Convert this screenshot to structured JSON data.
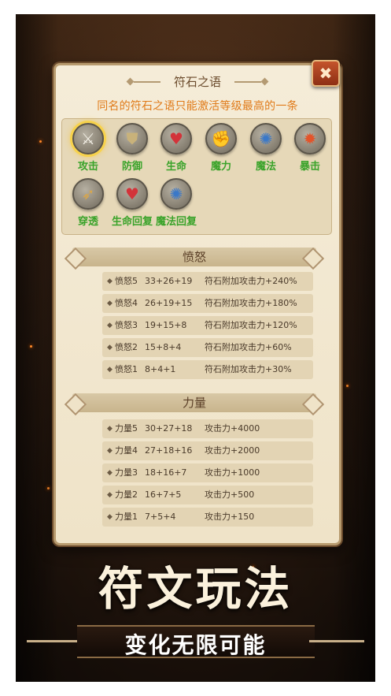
{
  "panel": {
    "title": "符石之语",
    "subtitle": "同名的符石之语只能激活等级最高的一条",
    "close_label": "✖"
  },
  "runes": [
    {
      "label": "攻击",
      "icon": "attack-rune-icon",
      "glyph": "⚔",
      "glyph_color": "#f3efe5",
      "selected": true
    },
    {
      "label": "防御",
      "icon": "defense-rune-icon",
      "glyph": "⛊",
      "glyph_color": "#c9b27a",
      "selected": false
    },
    {
      "label": "生命",
      "icon": "life-rune-icon",
      "glyph": "♥",
      "glyph_color": "#d3333a",
      "selected": false
    },
    {
      "label": "魔力",
      "icon": "mana-rune-icon",
      "glyph": "✊",
      "glyph_color": "#e6b93a",
      "selected": false
    },
    {
      "label": "魔法",
      "icon": "magic-rune-icon",
      "glyph": "✺",
      "glyph_color": "#3a78c8",
      "selected": false
    },
    {
      "label": "暴击",
      "icon": "crit-rune-icon",
      "glyph": "✹",
      "glyph_color": "#e3542a",
      "selected": false
    },
    {
      "label": "穿透",
      "icon": "pierce-rune-icon",
      "glyph": "➶",
      "glyph_color": "#d9a64a",
      "selected": false
    },
    {
      "label": "生命回复",
      "icon": "life-regen-rune-icon",
      "glyph": "♥",
      "glyph_color": "#d3333a",
      "selected": false
    },
    {
      "label": "魔法回复",
      "icon": "mana-regen-rune-icon",
      "glyph": "✺",
      "glyph_color": "#3a78c8",
      "selected": false
    }
  ],
  "sections": [
    {
      "title": "愤怒",
      "rows": [
        {
          "name": "愤怒5",
          "combo": "33+26+19",
          "effect": "符石附加攻击力+240%"
        },
        {
          "name": "愤怒4",
          "combo": "26+19+15",
          "effect": "符石附加攻击力+180%"
        },
        {
          "name": "愤怒3",
          "combo": "19+15+8",
          "effect": "符石附加攻击力+120%"
        },
        {
          "name": "愤怒2",
          "combo": "15+8+4",
          "effect": "符石附加攻击力+60%"
        },
        {
          "name": "愤怒1",
          "combo": "8+4+1",
          "effect": "符石附加攻击力+30%"
        }
      ]
    },
    {
      "title": "力量",
      "rows": [
        {
          "name": "力量5",
          "combo": "30+27+18",
          "effect": "攻击力+4000"
        },
        {
          "name": "力量4",
          "combo": "27+18+16",
          "effect": "攻击力+2000"
        },
        {
          "name": "力量3",
          "combo": "18+16+7",
          "effect": "攻击力+1000"
        },
        {
          "name": "力量2",
          "combo": "16+7+5",
          "effect": "攻击力+500"
        },
        {
          "name": "力量1",
          "combo": "7+5+4",
          "effect": "攻击力+150"
        }
      ]
    }
  ],
  "promo": {
    "slogan": "符文玩法",
    "tagline": "变化无限可能"
  },
  "colors": {
    "accent_orange": "#e07b1a",
    "rune_label_green": "#3aa32a",
    "close_red": "#b2431f"
  }
}
